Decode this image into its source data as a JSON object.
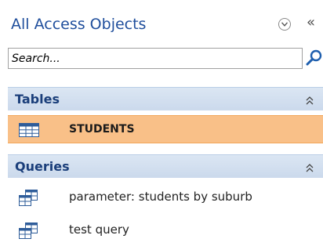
{
  "pane": {
    "title": "All Access Objects",
    "dropdown_icon": "chevron-down-circle-icon",
    "collapse_icon": "double-chevron-left-icon",
    "collapse_glyph": "«"
  },
  "search": {
    "placeholder": "Search...",
    "value": "",
    "icon": "search-icon"
  },
  "groups": [
    {
      "title": "Tables",
      "icon": "collapse-up-icon",
      "items": [
        {
          "label": "STUDENTS",
          "icon": "table-icon",
          "selected": true
        }
      ]
    },
    {
      "title": "Queries",
      "icon": "collapse-up-icon",
      "items": [
        {
          "label": "parameter: students by suburb",
          "icon": "query-icon",
          "selected": false
        },
        {
          "label": "test query",
          "icon": "query-icon",
          "selected": false
        }
      ]
    }
  ],
  "colors": {
    "title": "#1f4e9c",
    "group_header": "#cbd9ec",
    "selected_row": "#f9c088"
  }
}
